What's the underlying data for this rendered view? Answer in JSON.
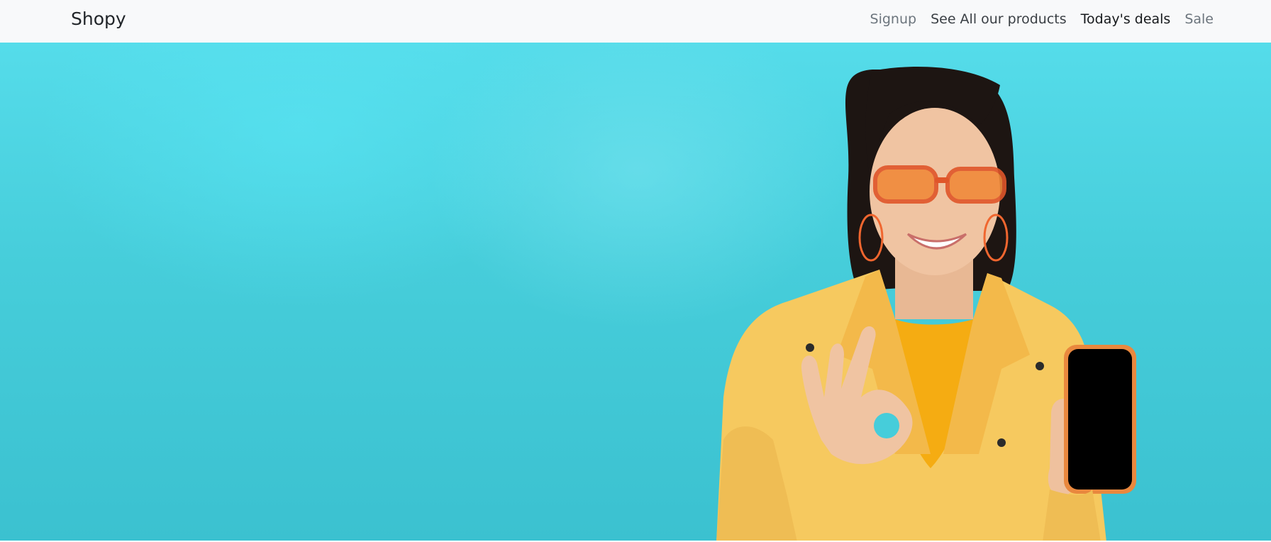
{
  "navbar": {
    "brand": "Shopy",
    "links": [
      {
        "label": "Signup",
        "state": "muted"
      },
      {
        "label": "See All our products",
        "state": "semi"
      },
      {
        "label": "Today's deals",
        "state": "active"
      },
      {
        "label": "Sale",
        "state": "muted"
      }
    ]
  },
  "colors": {
    "navbar_bg": "#f8f9fa",
    "hero_bg": "#46cdda",
    "jacket": "#f6c95f",
    "shirt": "#f5ac12",
    "glasses": "#f07a2c"
  },
  "hero": {
    "image": "hero-woman-phone-ok-gesture-icon"
  }
}
